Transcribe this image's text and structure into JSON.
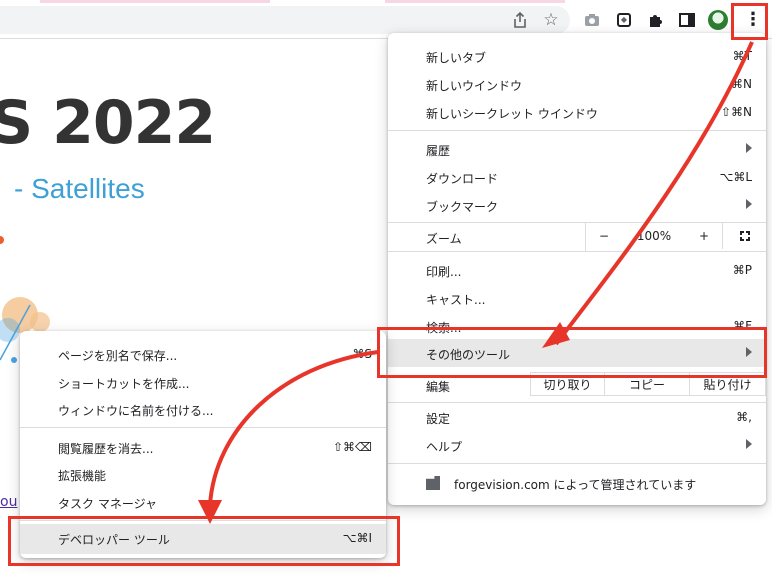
{
  "toolbar": {
    "icons": [
      "share-icon",
      "bookmark-star-icon",
      "camera-icon",
      "extension-box-icon",
      "puzzle-icon",
      "side-panel-icon",
      "profile-avatar",
      "more-vertical-icon"
    ],
    "more_glyph": "⋮"
  },
  "page": {
    "title": "S 2022",
    "subtitle": "- Satellites",
    "link_fragment": "ou"
  },
  "main_menu": {
    "new_tab": {
      "label": "新しいタブ",
      "shortcut": "⌘T"
    },
    "new_window": {
      "label": "新しいウインドウ",
      "shortcut": "⌘N"
    },
    "incognito": {
      "label": "新しいシークレット ウインドウ",
      "shortcut": "⇧⌘N"
    },
    "history": {
      "label": "履歴"
    },
    "downloads": {
      "label": "ダウンロード",
      "shortcut": "⌥⌘L"
    },
    "bookmarks": {
      "label": "ブックマーク"
    },
    "zoom": {
      "label": "ズーム",
      "minus": "−",
      "value": "100%",
      "plus": "+"
    },
    "print": {
      "label": "印刷...",
      "shortcut": "⌘P"
    },
    "cast": {
      "label": "キャスト..."
    },
    "find": {
      "label": "検索...",
      "shortcut": "⌘F"
    },
    "more_tools": {
      "label": "その他のツール"
    },
    "edit": {
      "label": "編集",
      "cut": "切り取り",
      "copy": "コピー",
      "paste": "貼り付け"
    },
    "settings": {
      "label": "設定",
      "shortcut": "⌘,"
    },
    "help": {
      "label": "ヘルプ"
    },
    "managed": {
      "label": "forgevision.com によって管理されています"
    }
  },
  "sub_menu": {
    "save_page": {
      "label": "ページを別名で保存...",
      "shortcut": "⌘S"
    },
    "create_shortcut": {
      "label": "ショートカットを作成..."
    },
    "name_window": {
      "label": "ウィンドウに名前を付ける..."
    },
    "clear_history": {
      "label": "閲覧履歴を消去...",
      "shortcut": "⇧⌘⌫"
    },
    "extensions": {
      "label": "拡張機能"
    },
    "task_manager": {
      "label": "タスク マネージャ"
    },
    "dev_tools": {
      "label": "デベロッパー ツール",
      "shortcut": "⌥⌘I"
    }
  },
  "colors": {
    "annotation": "#e8352a",
    "subtitle": "#3ea0d6",
    "highlight": "#e8e8e8"
  }
}
